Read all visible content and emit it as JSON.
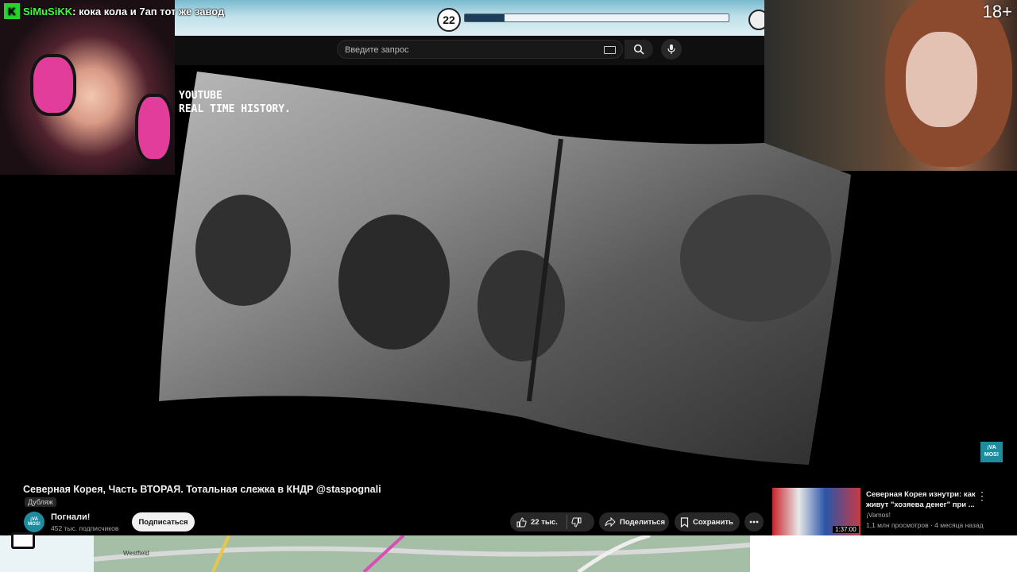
{
  "stream": {
    "chat_badge": "K",
    "chat_user": "SiMuSiKK",
    "chat_message": ": кока кола и 7ап тот же завод",
    "progress_number": "22",
    "progress_fraction": 0.15,
    "age_rating": "18+"
  },
  "search": {
    "placeholder": "Введите запрос"
  },
  "video": {
    "watermark_line1": "YOUTUBE",
    "watermark_line2": "REAL TIME HISTORY.",
    "channel_watermark": "¡VA MOS!",
    "title": "Северная Корея, Часть ВТОРАЯ. Тотальная слежка в КНДР @staspognali",
    "dub_label": "Дубляж"
  },
  "channel": {
    "avatar_text": "¡VA MOS!",
    "name": "Погнали!",
    "subscribers": "452 тыс. подписчиков",
    "subscribe_label": "Подписаться"
  },
  "actions": {
    "like_count": "22 тыс.",
    "share_label": "Поделиться",
    "save_label": "Сохранить"
  },
  "recommendation": {
    "title": "Северная Корея изнутри: как живут \"хозяева денег\" при ...",
    "channel": "¡Vamos!",
    "meta": "1,1 млн просмотров · 4 месяца назад",
    "duration": "1:37:00"
  },
  "map": {
    "label": "Westfield"
  },
  "colors": {
    "youtube_bg": "#0f0f0f",
    "chat_user": "#3cff3c",
    "brand_teal": "#1c8c9e"
  }
}
